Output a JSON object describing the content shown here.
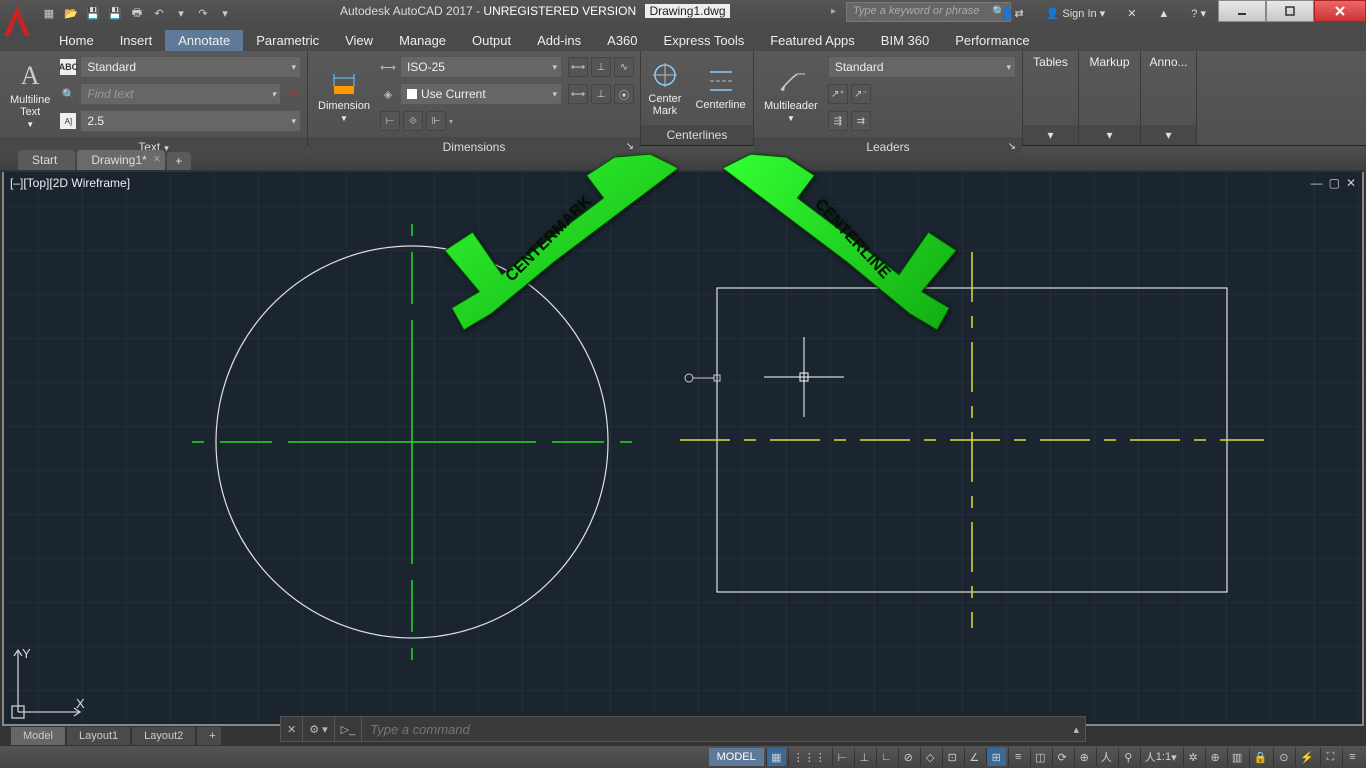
{
  "title_app": "Autodesk AutoCAD 2017 - ",
  "title_status": "UNREGISTERED VERSION",
  "title_file": "Drawing1.dwg",
  "search_placeholder": "Type a keyword or phrase",
  "signin": "Sign In",
  "tabs": [
    "Home",
    "Insert",
    "Annotate",
    "Parametric",
    "View",
    "Manage",
    "Output",
    "Add-ins",
    "A360",
    "Express Tools",
    "Featured Apps",
    "BIM 360",
    "Performance"
  ],
  "tabs_active": 2,
  "ribbon": {
    "text_panel": {
      "btn": "Multiline\nText",
      "style": "Standard",
      "find": "Find text",
      "height": "2.5",
      "title": "Text"
    },
    "dim_panel": {
      "btn": "Dimension",
      "style": "ISO-25",
      "layer": "Use Current",
      "title": "Dimensions"
    },
    "center_panel": {
      "btn1": "Center\nMark",
      "btn2": "Centerline",
      "title": "Centerlines"
    },
    "leader_panel": {
      "btn": "Multileader",
      "style": "Standard",
      "title": "Leaders"
    },
    "extra_panels": [
      "Tables",
      "Markup",
      "Anno..."
    ]
  },
  "filetabs": {
    "start": "Start",
    "drawing": "Drawing1*"
  },
  "viewport_label": "[–][Top][2D Wireframe]",
  "annotations": {
    "arrow1": "CENTERMARK",
    "arrow2": "CENTERLINE"
  },
  "command_placeholder": "Type a command",
  "layouts": [
    "Model",
    "Layout1",
    "Layout2"
  ],
  "statusbar": {
    "model": "MODEL",
    "scale": "1:1"
  },
  "axes": {
    "x": "X",
    "y": "Y"
  }
}
